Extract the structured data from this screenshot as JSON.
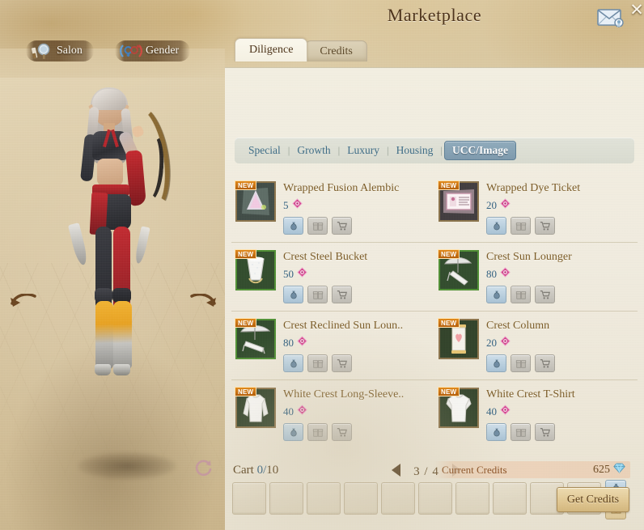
{
  "window": {
    "title": "Marketplace",
    "close_label": "✕",
    "mail_icon": "mail-envelope-icon",
    "close_icon": "close-x-icon"
  },
  "character_panel": {
    "pills": [
      {
        "label": "Salon",
        "icon": "comb-mirror-icon"
      },
      {
        "label": "Gender",
        "icon": "gender-symbols-icon"
      }
    ],
    "rotate_left_icon": "rotate-left-arrow-icon",
    "rotate_right_icon": "rotate-right-arrow-icon",
    "reset_icon": "reset-rotation-icon"
  },
  "tabs": [
    {
      "label": "Diligence",
      "active": true
    },
    {
      "label": "Credits",
      "active": false
    }
  ],
  "subnav": {
    "items": [
      {
        "label": "Special",
        "selected": false
      },
      {
        "label": "Growth",
        "selected": false
      },
      {
        "label": "Luxury",
        "selected": false
      },
      {
        "label": "Housing",
        "selected": false
      },
      {
        "label": "UCC/Image",
        "selected": true
      }
    ],
    "separator": "|"
  },
  "items": [
    {
      "name": "Wrapped Fusion Alembic",
      "price": "5",
      "badge": "NEW",
      "border": "gold",
      "art": "alembic-crystal-icon",
      "actions": [
        {
          "icon": "money-bag-icon",
          "state": "enabled"
        },
        {
          "icon": "gift-box-icon",
          "state": "disabled"
        },
        {
          "icon": "shopping-cart-icon",
          "state": "disabled"
        }
      ]
    },
    {
      "name": "Wrapped Dye Ticket",
      "price": "20",
      "badge": "NEW",
      "border": "gold",
      "art": "dye-ticket-icon",
      "actions": [
        {
          "icon": "money-bag-icon",
          "state": "enabled"
        },
        {
          "icon": "gift-box-icon",
          "state": "disabled"
        },
        {
          "icon": "shopping-cart-icon",
          "state": "disabled"
        }
      ]
    },
    {
      "name": "Crest Steel Bucket",
      "price": "50",
      "badge": "NEW",
      "border": "green",
      "art": "steel-bucket-icon",
      "actions": [
        {
          "icon": "money-bag-icon",
          "state": "enabled"
        },
        {
          "icon": "gift-box-icon",
          "state": "disabled"
        },
        {
          "icon": "shopping-cart-icon",
          "state": "disabled"
        }
      ]
    },
    {
      "name": "Crest Sun Lounger",
      "price": "80",
      "badge": "NEW",
      "border": "green",
      "art": "sun-lounger-icon",
      "actions": [
        {
          "icon": "money-bag-icon",
          "state": "enabled"
        },
        {
          "icon": "gift-box-icon",
          "state": "disabled"
        },
        {
          "icon": "shopping-cart-icon",
          "state": "disabled"
        }
      ]
    },
    {
      "name": "Crest Reclined Sun Loun..",
      "price": "80",
      "badge": "NEW",
      "border": "green",
      "art": "reclined-sun-lounger-icon",
      "actions": [
        {
          "icon": "money-bag-icon",
          "state": "enabled"
        },
        {
          "icon": "gift-box-icon",
          "state": "disabled"
        },
        {
          "icon": "shopping-cart-icon",
          "state": "disabled"
        }
      ]
    },
    {
      "name": "Crest Column",
      "price": "20",
      "badge": "NEW",
      "border": "gold",
      "art": "heart-column-icon",
      "actions": [
        {
          "icon": "money-bag-icon",
          "state": "enabled"
        },
        {
          "icon": "gift-box-icon",
          "state": "disabled"
        },
        {
          "icon": "shopping-cart-icon",
          "state": "disabled"
        }
      ]
    },
    {
      "name": "White Crest Long-Sleeve..",
      "price": "40",
      "badge": "NEW",
      "border": "gold",
      "art": "long-sleeve-shirt-icon",
      "actions": [
        {
          "icon": "money-bag-icon",
          "state": "enabled"
        },
        {
          "icon": "gift-box-icon",
          "state": "disabled"
        },
        {
          "icon": "shopping-cart-icon",
          "state": "disabled"
        }
      ]
    },
    {
      "name": "White Crest T-Shirt",
      "price": "40",
      "badge": "NEW",
      "border": "gold",
      "art": "t-shirt-icon",
      "actions": [
        {
          "icon": "money-bag-icon",
          "state": "enabled"
        },
        {
          "icon": "gift-box-icon",
          "state": "disabled"
        },
        {
          "icon": "shopping-cart-icon",
          "state": "disabled"
        }
      ]
    }
  ],
  "cart": {
    "label": "Cart",
    "count": "0",
    "separator": "/",
    "max": "10",
    "slot_count": 10,
    "buy_icon": "money-bag-icon",
    "gift_icon": "gift-box-icon"
  },
  "pagination": {
    "current": "3",
    "separator": "/",
    "total": "4",
    "display": "3 / 4",
    "prev_icon": "triangle-left-icon",
    "next_icon": "triangle-right-icon"
  },
  "credits": {
    "label": "Current Credits",
    "amount": "625",
    "gem_icon": "blue-diamond-icon",
    "get_button": "Get Credits"
  },
  "colors": {
    "accent_blue": "#3b6b86",
    "selected_tab_bg": "#7d99ad",
    "title_brown": "#4b3118",
    "item_name_brown": "#7a5a24",
    "price_blue": "#2f5f80",
    "new_badge_orange": "#c4690e",
    "credits_label": "#8a4f21",
    "panel_bg": "#f2ede0",
    "gem_pink": "#d4418c",
    "gem_blue": "#7fc8e8"
  }
}
